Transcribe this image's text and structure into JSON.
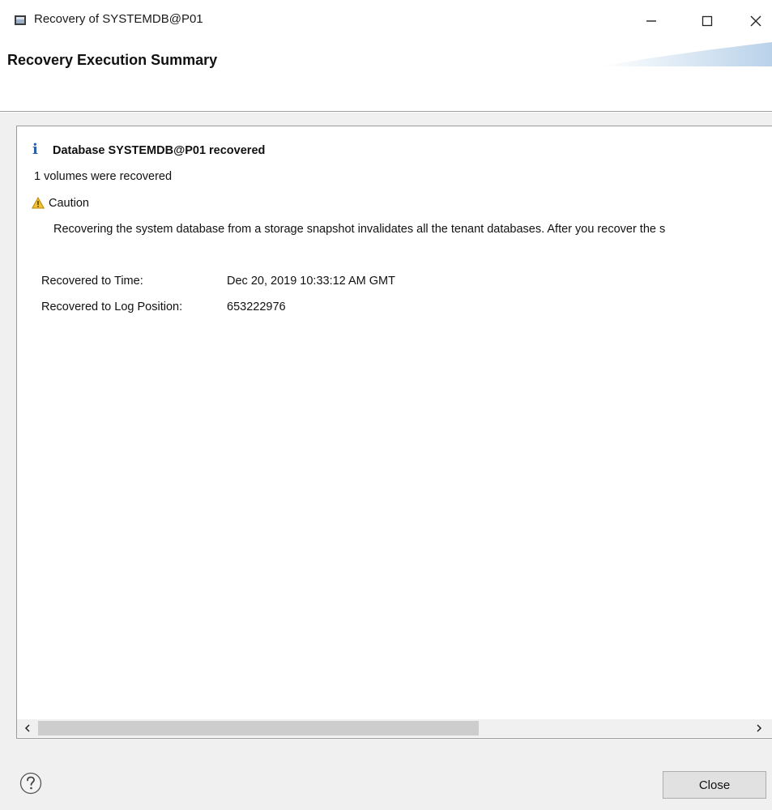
{
  "window": {
    "title": "Recovery of SYSTEMDB@P01",
    "app_icon": "sap-studio-icon",
    "controls": [
      "minimize-icon",
      "maximize-icon",
      "close-icon"
    ]
  },
  "banner": {
    "title": "Recovery Execution Summary"
  },
  "summary": {
    "info_icon": "info-icon",
    "heading": "Database SYSTEMDB@P01 recovered",
    "volumes_text": "1 volumes were recovered",
    "caution_icon": "warning-icon",
    "caution_label": "Caution",
    "caution_message": "Recovering the system database from a storage snapshot invalidates all the tenant databases. After you recover the s",
    "details": [
      {
        "label": "Recovered to Time:",
        "value": "Dec 20, 2019 10:33:12 AM GMT"
      },
      {
        "label": "Recovered to Log Position:",
        "value": "653222976"
      }
    ]
  },
  "footer": {
    "help_icon": "help-icon",
    "close_label": "Close"
  },
  "colors": {
    "info_blue": "#2b5fa8",
    "warning_yellow": "#f2c12e",
    "dialog_grey": "#f0f0f0"
  }
}
